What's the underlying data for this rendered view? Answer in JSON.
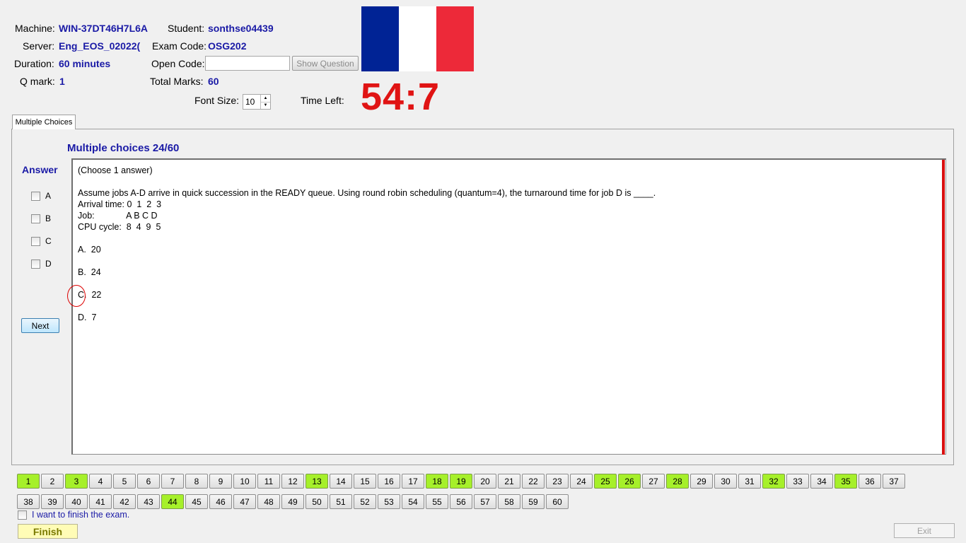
{
  "header": {
    "machine_label": "Machine:",
    "machine_value": "WIN-37DT46H7L6A",
    "student_label": "Student:",
    "student_value": "sonthse04439",
    "server_label": "Server:",
    "server_value": "Eng_EOS_02022(",
    "exam_code_label": "Exam Code:",
    "exam_code_value": "OSG202",
    "duration_label": "Duration:",
    "duration_value": "60 minutes",
    "open_code_label": "Open Code:",
    "open_code_value": "",
    "show_question_label": "Show Question",
    "qmark_label": "Q mark:",
    "qmark_value": "1",
    "total_marks_label": "Total Marks:",
    "total_marks_value": "60",
    "font_size_label": "Font Size:",
    "font_size_value": "10",
    "time_left_label": "Time Left:",
    "time_left_value": "54:7",
    "flag_colors": [
      "#002395",
      "#ffffff",
      "#ed2939"
    ]
  },
  "tab": {
    "label": "Multiple Choices"
  },
  "question": {
    "heading": "Multiple choices 24/60",
    "answer_label": "Answer",
    "options": [
      "A",
      "B",
      "C",
      "D"
    ],
    "next_label": "Next",
    "lines": [
      "(Choose 1 answer)",
      "",
      "Assume jobs A-D arrive in quick succession in the READY queue. Using round robin scheduling (quantum=4), the turnaround time for job D is ____.",
      "Arrival time: 0  1  2  3",
      "Job:             A B C D",
      "CPU cycle:  8  4  9  5",
      "",
      "A.  20",
      "",
      "B.  24",
      "",
      "C.  22",
      "",
      "D.  7"
    ]
  },
  "navigator": {
    "total": 60,
    "answered": [
      1,
      3,
      13,
      18,
      19,
      25,
      26,
      28,
      32,
      35,
      44
    ],
    "answered_color": "#a6f02a"
  },
  "footer": {
    "finish_checkbox_label": "I want to finish the exam.",
    "finish_label": "Finish",
    "exit_label": "Exit"
  }
}
